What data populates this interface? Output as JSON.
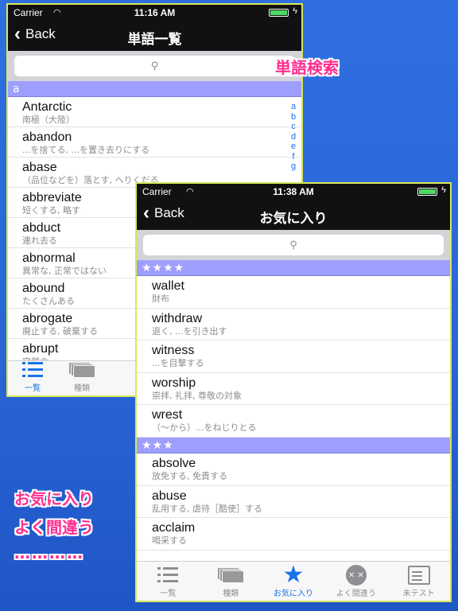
{
  "back_screen": {
    "status": {
      "carrier": "Carrier",
      "time": "11:16 AM"
    },
    "nav": {
      "back_label": "Back",
      "title": "単語一覧"
    },
    "section": "a",
    "index_letters": [
      "a",
      "b",
      "c",
      "d",
      "e",
      "f",
      "g"
    ],
    "words": [
      {
        "word": "Antarctic",
        "meaning": "南極（大陸）"
      },
      {
        "word": "abandon",
        "meaning": "...を捨てる, ...を置き去りにする"
      },
      {
        "word": "abase",
        "meaning": "（品位などを）落とす, へりくだる"
      },
      {
        "word": "abbreviate",
        "meaning": "短くする, 略す"
      },
      {
        "word": "abduct",
        "meaning": "連れ去る"
      },
      {
        "word": "abnormal",
        "meaning": "異常な, 正常ではない"
      },
      {
        "word": "abound",
        "meaning": "たくさんある"
      },
      {
        "word": "abrogate",
        "meaning": "廃止する, 破棄する"
      },
      {
        "word": "abrupt",
        "meaning": "突然の"
      }
    ],
    "tabs": [
      {
        "label": "一覧",
        "icon": "list-icon",
        "active": true
      },
      {
        "label": "種類",
        "icon": "cards-icon",
        "active": false
      }
    ]
  },
  "front_screen": {
    "status": {
      "carrier": "Carrier",
      "time": "11:38 AM"
    },
    "nav": {
      "back_label": "Back",
      "title": "お気に入り"
    },
    "sections": [
      {
        "header": "★★★★",
        "words": [
          {
            "word": "wallet",
            "meaning": "財布"
          },
          {
            "word": "withdraw",
            "meaning": "退く, ...を引き出す"
          },
          {
            "word": "witness",
            "meaning": "...を目撃する"
          },
          {
            "word": "worship",
            "meaning": "崇拝, 礼拝, 尊敬の対象"
          },
          {
            "word": "wrest",
            "meaning": "（〜から）...をねじりとる"
          }
        ]
      },
      {
        "header": "★★★",
        "words": [
          {
            "word": "absolve",
            "meaning": "放免する, 免責する"
          },
          {
            "word": "abuse",
            "meaning": "乱用する, 虐待［酷使］する"
          },
          {
            "word": "acclaim",
            "meaning": "喝采する"
          }
        ]
      }
    ],
    "tabs": [
      {
        "label": "一覧",
        "icon": "list-icon",
        "active": false
      },
      {
        "label": "種類",
        "icon": "cards-icon",
        "active": false
      },
      {
        "label": "お気に入り",
        "icon": "star-icon",
        "active": true
      },
      {
        "label": "よく間違う",
        "icon": "face-icon",
        "active": false
      },
      {
        "label": "未テスト",
        "icon": "test-icon",
        "active": false
      }
    ]
  },
  "callouts": {
    "search": "単語検索",
    "favorites": "お気に入り",
    "mistakes": "よく間違う",
    "more": "…………"
  },
  "colors": {
    "background": "#2f6fe0",
    "accent": "#1a73e8",
    "section_header": "#9e9eff",
    "callout": "#ff2e8f",
    "frame_border": "#d8e85a"
  }
}
